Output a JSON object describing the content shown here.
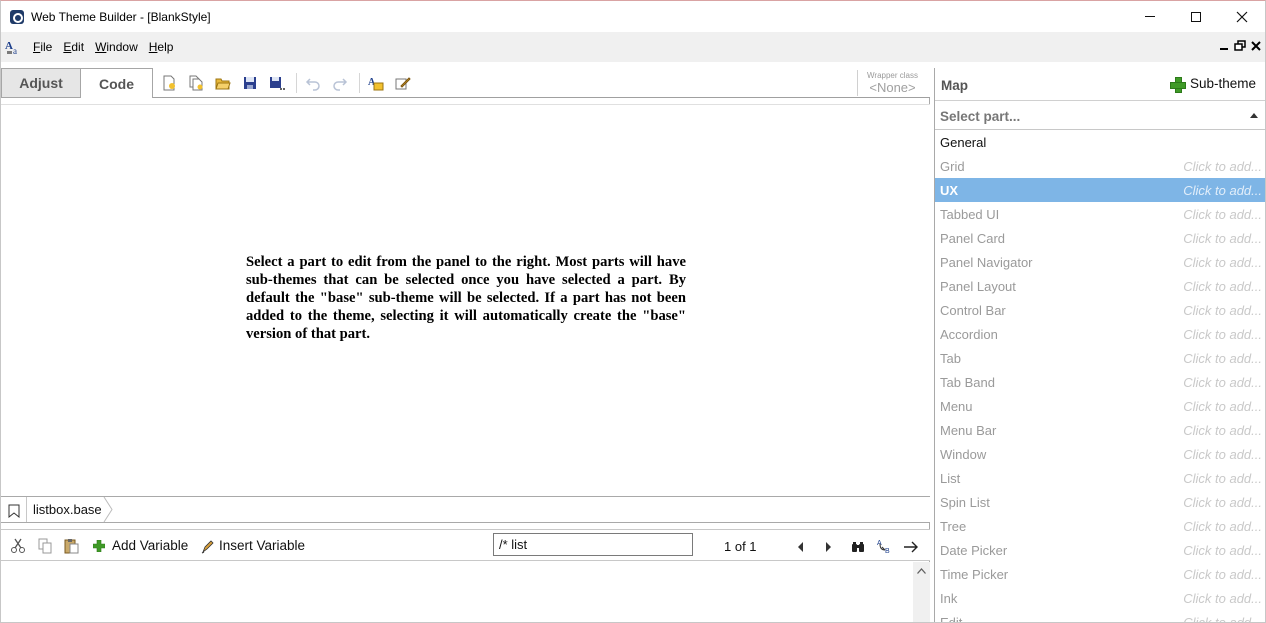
{
  "window": {
    "title": "Web Theme Builder - [BlankStyle]"
  },
  "menubar": {
    "items": [
      {
        "id": "file",
        "accel": "F",
        "rest": "ile"
      },
      {
        "id": "edit",
        "accel": "E",
        "rest": "dit"
      },
      {
        "id": "window",
        "accel": "W",
        "rest": "indow"
      },
      {
        "id": "help",
        "accel": "H",
        "rest": "elp"
      }
    ]
  },
  "left": {
    "tabs": {
      "adjust": "Adjust",
      "code": "Code"
    },
    "wrapper": {
      "label": "Wrapper class",
      "value": "<None>"
    },
    "instruction": "Select a part to edit from the panel to the right. Most parts will have sub-themes that can be selected once you have selected a part. By default the \"base\" sub-theme will be selected. If a part has not been added to the theme, selecting it will automatically create the \"base\" version of that part.",
    "breadcrumb": "listbox.base",
    "code_toolbar": {
      "add_variable": "Add Variable",
      "insert_variable": "Insert Variable",
      "find_value": "/* list",
      "find_count": "1 of 1"
    }
  },
  "right": {
    "map_title": "Map",
    "subtheme_label": "Sub-theme",
    "select_placeholder": "Select part...",
    "add_hint": "Click to add...",
    "parts": [
      {
        "name": "General",
        "state": "general"
      },
      {
        "name": "Grid",
        "state": "normal"
      },
      {
        "name": "UX",
        "state": "selected"
      },
      {
        "name": "Tabbed UI",
        "state": "normal"
      },
      {
        "name": "Panel Card",
        "state": "normal"
      },
      {
        "name": "Panel Navigator",
        "state": "normal"
      },
      {
        "name": "Panel Layout",
        "state": "normal"
      },
      {
        "name": "Control Bar",
        "state": "normal"
      },
      {
        "name": "Accordion",
        "state": "normal"
      },
      {
        "name": "Tab",
        "state": "normal"
      },
      {
        "name": "Tab Band",
        "state": "normal"
      },
      {
        "name": "Menu",
        "state": "normal"
      },
      {
        "name": "Menu Bar",
        "state": "normal"
      },
      {
        "name": "Window",
        "state": "normal"
      },
      {
        "name": "List",
        "state": "normal"
      },
      {
        "name": "Spin List",
        "state": "normal"
      },
      {
        "name": "Tree",
        "state": "normal"
      },
      {
        "name": "Date Picker",
        "state": "normal"
      },
      {
        "name": "Time Picker",
        "state": "normal"
      },
      {
        "name": "Ink",
        "state": "normal"
      },
      {
        "name": "Edit",
        "state": "normal"
      }
    ]
  },
  "colors": {
    "selected_row": "#7eb5e6",
    "accent_green": "#3f9a27"
  }
}
